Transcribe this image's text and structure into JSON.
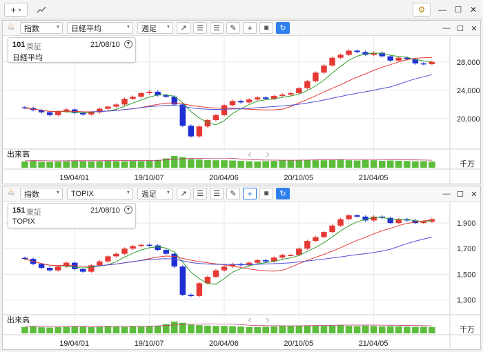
{
  "topbar": {
    "add_label": "+",
    "add_caret": "▾",
    "chart_icon": "chart-line-icon"
  },
  "window": {
    "minimize": "—",
    "maximize": "☐",
    "close": "✕"
  },
  "colors": {
    "up": "#e53935",
    "down": "#1e2fd6",
    "ma_short": "#2e9d2e",
    "ma_mid": "#e53935",
    "ma_long": "#4d4dd6",
    "volume": "#5bbd3a",
    "accent": "#2f80ed"
  },
  "panels": [
    {
      "type_select": "指数",
      "symbol_select": "日経平均",
      "period_select": "週足",
      "info": {
        "code": "101",
        "exchange": "東証",
        "date": "21/08/10",
        "name": "日経平均"
      },
      "volume_label": "出来高",
      "volume_unit": "千万",
      "y_ticks": [
        "28,000",
        "24,000",
        "20,000"
      ],
      "x_ticks": [
        "19/04/01",
        "19/10/07",
        "20/04/06",
        "20/10/05",
        "21/04/05"
      ]
    },
    {
      "type_select": "指数",
      "symbol_select": "TOPIX",
      "period_select": "週足",
      "info": {
        "code": "151",
        "exchange": "東証",
        "date": "21/08/10",
        "name": "TOPIX"
      },
      "volume_label": "出来高",
      "volume_unit": "千万",
      "y_ticks": [
        "1,900",
        "1,700",
        "1,500",
        "1,300"
      ],
      "x_ticks": [
        "19/04/01",
        "19/10/07",
        "20/04/06",
        "20/10/05",
        "21/04/05"
      ]
    }
  ],
  "chart_data": [
    {
      "type": "candlestick",
      "title": "日経平均",
      "period": "weekly",
      "x": [
        "19/04/01",
        "19/10/07",
        "20/04/06",
        "20/10/05",
        "21/04/05"
      ],
      "ylim": [
        16000,
        31000
      ],
      "close": [
        21500,
        21200,
        20900,
        20500,
        21000,
        21300,
        20800,
        20600,
        20900,
        21400,
        21700,
        22000,
        22800,
        23100,
        23600,
        23800,
        23300,
        23100,
        22000,
        19000,
        17500,
        18900,
        19800,
        20500,
        21900,
        22500,
        22300,
        22700,
        23000,
        22800,
        23200,
        23400,
        23600,
        24300,
        25300,
        26500,
        27500,
        28600,
        29000,
        29600,
        29400,
        29000,
        29300,
        28800,
        28200,
        28600,
        28400,
        27800,
        27700,
        28000
      ],
      "volume": [
        0.5,
        0.55,
        0.48,
        0.47,
        0.5,
        0.52,
        0.55,
        0.53,
        0.5,
        0.52,
        0.55,
        0.53,
        0.52,
        0.55,
        0.54,
        0.56,
        0.6,
        0.75,
        0.95,
        0.85,
        0.7,
        0.66,
        0.62,
        0.6,
        0.6,
        0.58,
        0.55,
        0.52,
        0.5,
        0.53,
        0.55,
        0.6,
        0.58,
        0.6,
        0.62,
        0.6,
        0.6,
        0.62,
        0.66,
        0.6,
        0.58,
        0.62,
        0.6,
        0.56,
        0.58,
        0.56,
        0.54,
        0.52,
        0.53,
        0.5
      ]
    },
    {
      "type": "candlestick",
      "title": "TOPIX",
      "period": "weekly",
      "x": [
        "19/04/01",
        "19/10/07",
        "20/04/06",
        "20/10/05",
        "21/04/05"
      ],
      "ylim": [
        1200,
        2030
      ],
      "close": [
        1620,
        1580,
        1550,
        1530,
        1560,
        1590,
        1540,
        1520,
        1570,
        1600,
        1640,
        1660,
        1700,
        1720,
        1730,
        1725,
        1690,
        1660,
        1560,
        1340,
        1330,
        1430,
        1480,
        1530,
        1560,
        1580,
        1570,
        1590,
        1610,
        1600,
        1630,
        1650,
        1650,
        1700,
        1760,
        1790,
        1830,
        1880,
        1930,
        1960,
        1950,
        1920,
        1950,
        1940,
        1900,
        1930,
        1920,
        1900,
        1910,
        1930
      ],
      "volume": [
        0.5,
        0.54,
        0.49,
        0.47,
        0.5,
        0.52,
        0.55,
        0.53,
        0.5,
        0.52,
        0.55,
        0.53,
        0.52,
        0.55,
        0.54,
        0.56,
        0.6,
        0.75,
        0.95,
        0.85,
        0.7,
        0.66,
        0.62,
        0.6,
        0.6,
        0.58,
        0.55,
        0.52,
        0.5,
        0.53,
        0.55,
        0.6,
        0.58,
        0.6,
        0.62,
        0.6,
        0.6,
        0.62,
        0.66,
        0.6,
        0.58,
        0.62,
        0.6,
        0.56,
        0.58,
        0.56,
        0.54,
        0.52,
        0.53,
        0.5
      ]
    }
  ]
}
